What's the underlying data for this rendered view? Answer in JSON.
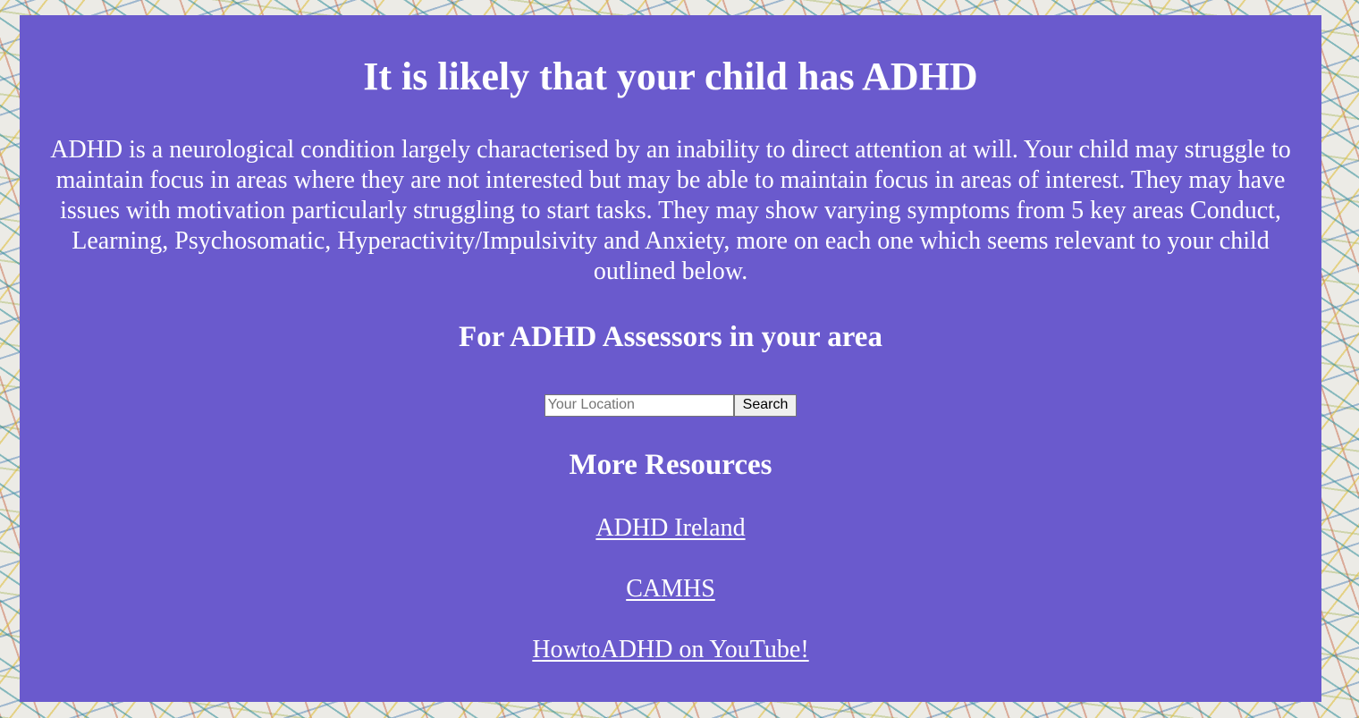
{
  "page": {
    "title": "It is likely that your child has ADHD",
    "intro": "ADHD is a neurological condition largely characterised by an inability to direct attention at will. Your child may struggle to maintain focus in areas where they are not interested but may be able to maintain focus in areas of interest. They may have issues with motivation particularly struggling to start tasks. They may show varying symptoms from 5 key areas Conduct, Learning, Psychosomatic, Hyperactivity/Impulsivity and Anxiety, more on each one which seems relevant to your child outlined below."
  },
  "assessors": {
    "heading": "For ADHD Assessors in your area",
    "search": {
      "placeholder": "Your Location",
      "value": "",
      "button_label": "Search"
    }
  },
  "resources": {
    "heading": "More Resources",
    "links": [
      {
        "label": "ADHD Ireland"
      },
      {
        "label": "CAMHS"
      },
      {
        "label": "HowtoADHD on YouTube!"
      }
    ]
  },
  "colors": {
    "panel_background": "#6a5acd",
    "text": "#ffffff"
  }
}
